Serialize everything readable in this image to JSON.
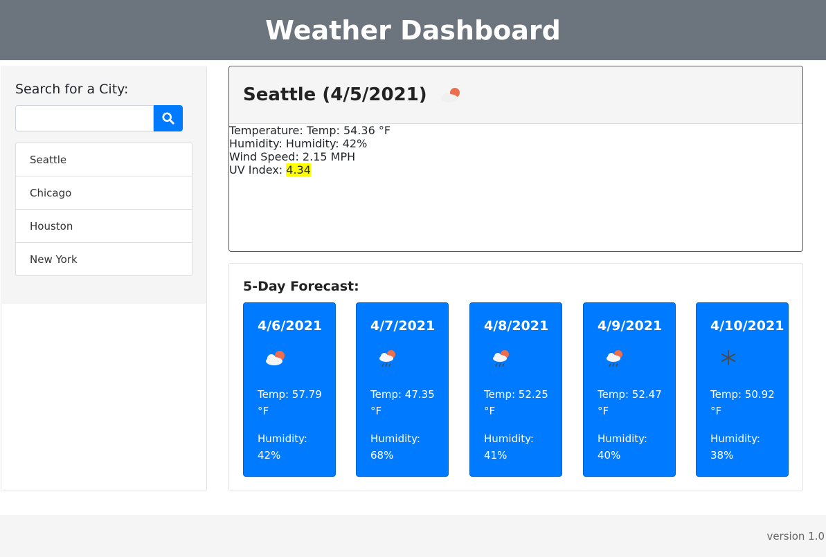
{
  "header": {
    "title": "Weather Dashboard"
  },
  "sidebar": {
    "label": "Search for a City:",
    "search_value": "",
    "search_placeholder": "",
    "cities": [
      "Seattle",
      "Chicago",
      "Houston",
      "New York"
    ]
  },
  "current": {
    "title": "Seattle (4/5/2021)",
    "icon": "cloud-sun-icon",
    "temperature_label": "Temperature: Temp: 54.36 °F",
    "humidity_label": "Humidity: Humidity: 42%",
    "wind_label": "Wind Speed: 2.15 MPH",
    "uv_label": "UV Index: ",
    "uv_value": "4.34",
    "uv_color": "#ffff00"
  },
  "forecast": {
    "title": "5-Day Forecast:",
    "days": [
      {
        "date": "4/6/2021",
        "icon": "cloud-sun-icon",
        "temp": "Temp: 57.79 °F",
        "humidity": "Humidity: 42%"
      },
      {
        "date": "4/7/2021",
        "icon": "rain-sun-icon",
        "temp": "Temp: 47.35 °F",
        "humidity": "Humidity: 68%"
      },
      {
        "date": "4/8/2021",
        "icon": "rain-sun-icon",
        "temp": "Temp: 52.25 °F",
        "humidity": "Humidity: 41%"
      },
      {
        "date": "4/9/2021",
        "icon": "rain-sun-icon",
        "temp": "Temp: 52.47 °F",
        "humidity": "Humidity: 40%"
      },
      {
        "date": "4/10/2021",
        "icon": "snowflake-icon",
        "temp": "Temp: 50.92 °F",
        "humidity": "Humidity: 38%"
      }
    ]
  },
  "footer": {
    "version": "version 1.0"
  },
  "colors": {
    "header": "#6c757d",
    "accent": "#007bff"
  }
}
